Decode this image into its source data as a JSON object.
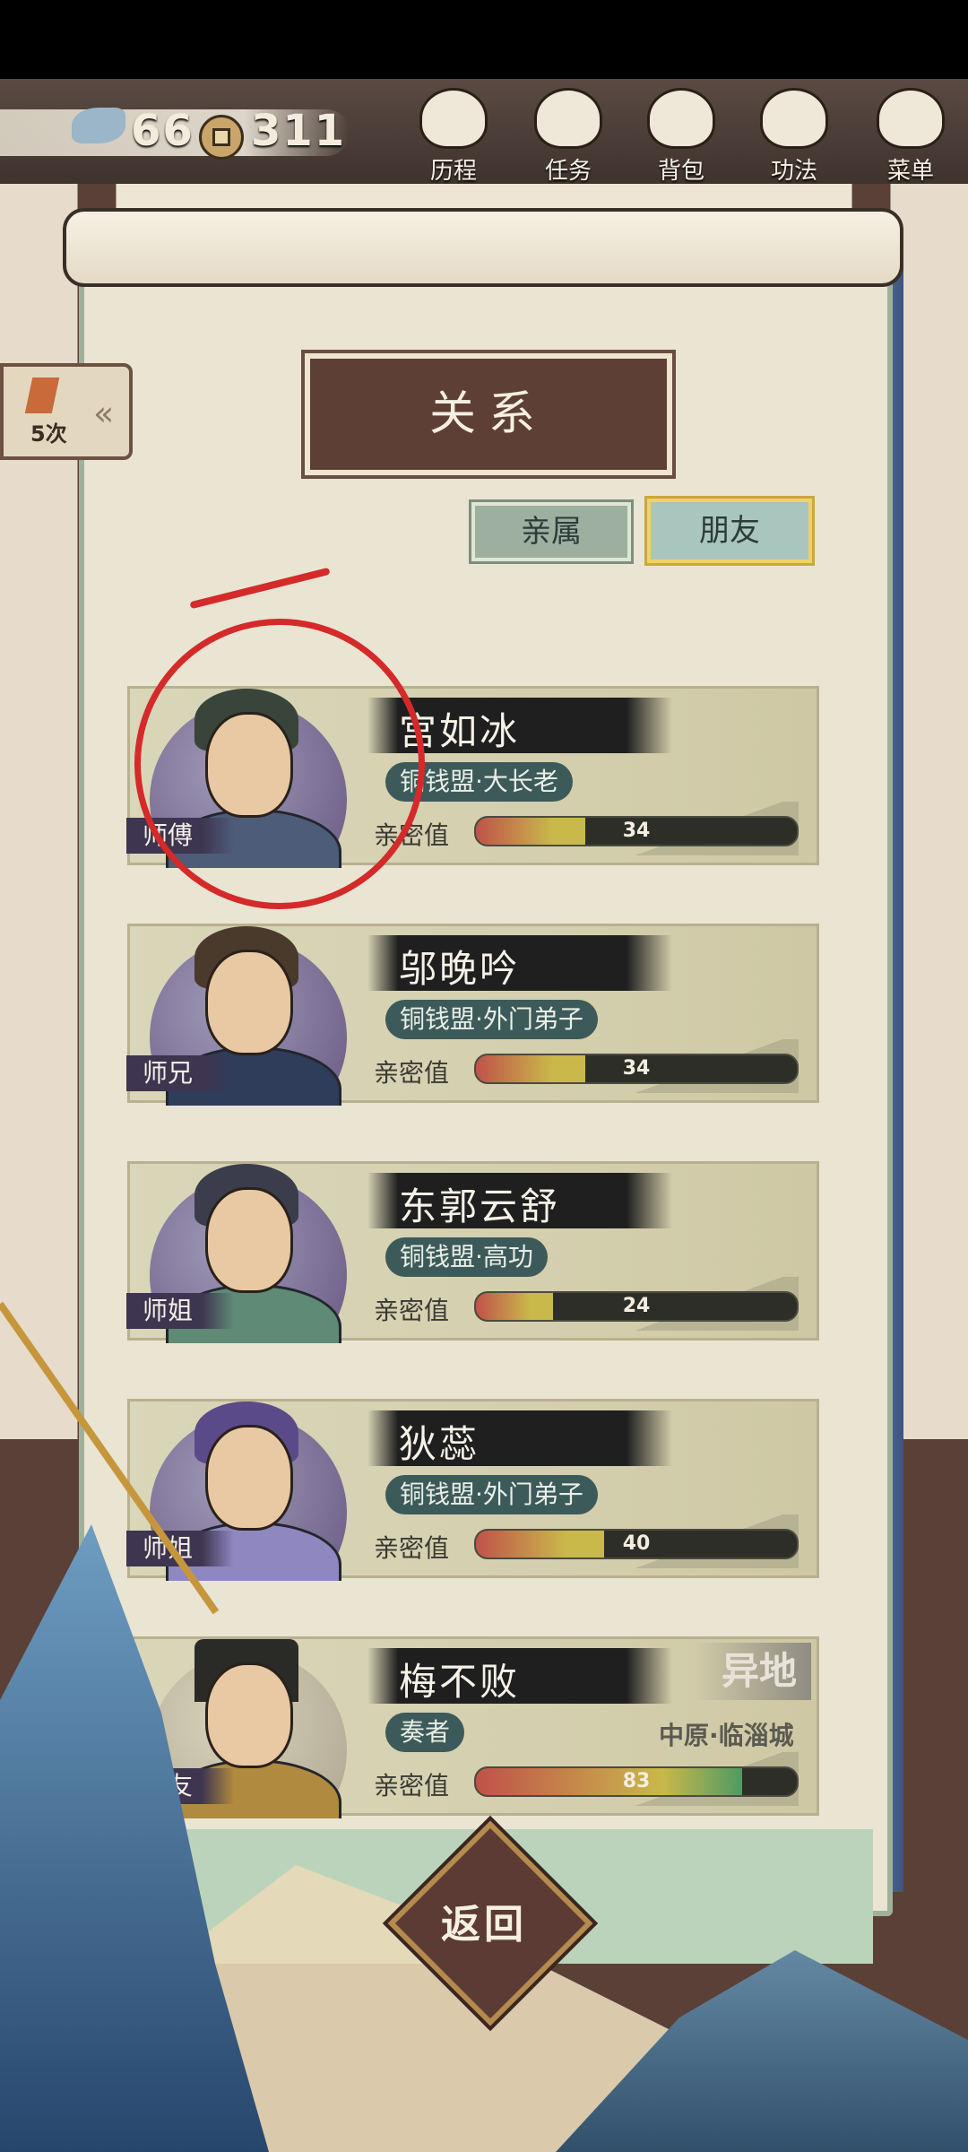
{
  "resources": {
    "jade": "66",
    "coins": "311"
  },
  "nav": [
    {
      "label": "历程",
      "icon": "history-icon"
    },
    {
      "label": "任务",
      "icon": "quest-icon"
    },
    {
      "label": "背包",
      "icon": "bag-icon"
    },
    {
      "label": "功法",
      "icon": "skill-scroll-icon"
    },
    {
      "label": "菜单",
      "icon": "fan-menu-icon"
    }
  ],
  "side_counter": {
    "count": "5次"
  },
  "page": {
    "title": "关系"
  },
  "tabs": [
    {
      "label": "亲属",
      "active": false
    },
    {
      "label": "朋友",
      "active": true
    }
  ],
  "intimacy_label": "亲密值",
  "contacts": [
    {
      "name": "宫如冰",
      "role": "师傅",
      "faction": "铜钱盟·大长老",
      "intimacy": 34
    },
    {
      "name": "邬晚吟",
      "role": "师兄",
      "faction": "铜钱盟·外门弟子",
      "intimacy": 34
    },
    {
      "name": "东郭云舒",
      "role": "师姐",
      "faction": "铜钱盟·高功",
      "intimacy": 24
    },
    {
      "name": "狄蕊",
      "role": "师姐",
      "faction": "铜钱盟·外门弟子",
      "intimacy": 40
    },
    {
      "name": "梅不败",
      "role": "朋友",
      "faction": "奏者",
      "intimacy": 83,
      "badge": "异地",
      "location": "中原·临淄城"
    }
  ],
  "return_label": "返回",
  "colors": {
    "accent_red": "#d42a2a",
    "bar_low": "#c0524a",
    "bar_high": "#4f9a63"
  }
}
